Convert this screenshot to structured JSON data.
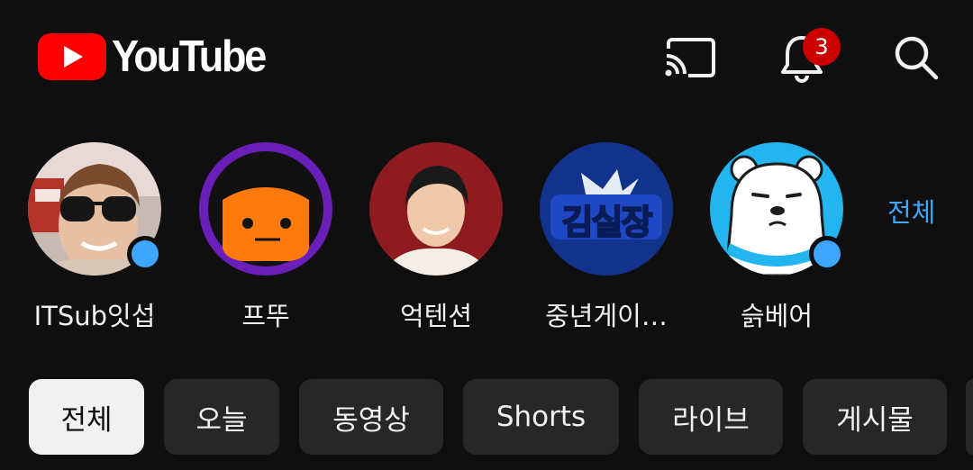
{
  "header": {
    "logo_text": "YouTube",
    "notifications_count": "3",
    "icons": [
      "cast-icon",
      "bell-icon",
      "search-icon"
    ],
    "colors": {
      "brand_red": "#ff0000",
      "badge_red": "#cc0000"
    }
  },
  "subscriptions": {
    "channels": [
      {
        "name": "ITSub잇섭",
        "has_new": true
      },
      {
        "name": "프뚜",
        "has_new": false
      },
      {
        "name": "억텐션",
        "has_new": false
      },
      {
        "name": "중년게이…",
        "has_new": false,
        "logo_text": "김실장"
      },
      {
        "name": "슭베어",
        "has_new": true
      }
    ],
    "all_label": "전체",
    "accent": "#3ea6ff"
  },
  "chips": {
    "items": [
      {
        "label": "전체",
        "active": true
      },
      {
        "label": "오늘",
        "active": false
      },
      {
        "label": "동영상",
        "active": false
      },
      {
        "label": "Shorts",
        "active": false
      },
      {
        "label": "라이브",
        "active": false
      },
      {
        "label": "게시물",
        "active": false
      }
    ]
  }
}
